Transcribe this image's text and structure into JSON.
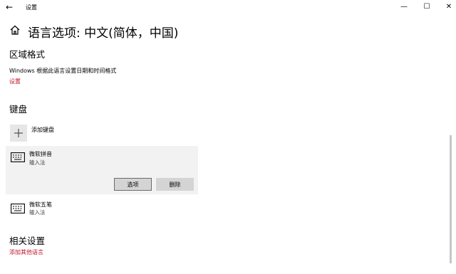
{
  "window": {
    "title": "设置",
    "back_glyph": "←",
    "minimize_glyph": "—",
    "maximize_glyph": "☐",
    "close_glyph": "✕"
  },
  "page": {
    "title": "语言选项: 中文(简体，中国)"
  },
  "region_format": {
    "heading": "区域格式",
    "description": "Windows 根据此语言设置日期和时间格式",
    "settings_link": "设置"
  },
  "keyboard": {
    "heading": "键盘",
    "add_label": "添加键盘",
    "items": [
      {
        "name": "微软拼音",
        "type": "输入法"
      },
      {
        "name": "微软五笔",
        "type": "输入法"
      }
    ],
    "options_button": "选项",
    "remove_button": "删除"
  },
  "related": {
    "heading": "相关设置",
    "add_other_languages_link": "添加其他语言"
  }
}
